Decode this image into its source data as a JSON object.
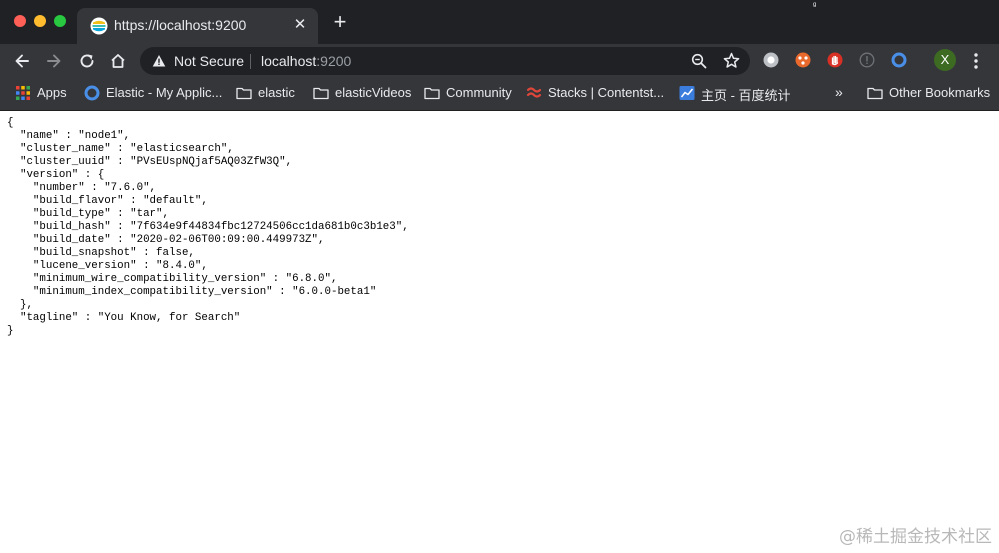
{
  "window": {
    "tab": {
      "title": "https://localhost:9200",
      "close_glyph": "✕",
      "favicon": "elastic-favicon-icon"
    },
    "new_tab_glyph": "+",
    "top_right_glyph": "ᵍ"
  },
  "toolbar": {
    "omnibox": {
      "security_label": "Not Secure",
      "host": "localhost",
      "port": ":9200"
    },
    "profile_initial": "X",
    "extensions": [
      "extension-grey-icon",
      "extension-orange-icon",
      "extension-red-hand-icon",
      "extension-info-icon",
      "extension-blue-ring-icon"
    ]
  },
  "bookmarks": {
    "items": [
      {
        "label": "Apps",
        "icon": "apps-grid-icon"
      },
      {
        "label": "Elastic - My Applic...",
        "icon": "circle-blue-icon"
      },
      {
        "label": "elastic",
        "icon": "folder-icon"
      },
      {
        "label": "elasticVideos",
        "icon": "folder-icon"
      },
      {
        "label": "Community",
        "icon": "folder-icon"
      },
      {
        "label": "Stacks | Contentst...",
        "icon": "contentstack-icon"
      },
      {
        "label": "主页 - 百度统计",
        "icon": "chart-icon"
      }
    ],
    "more_glyph": "»",
    "other": {
      "label": "Other Bookmarks",
      "icon": "folder-icon"
    }
  },
  "page": {
    "json_text": "{\n  \"name\" : \"node1\",\n  \"cluster_name\" : \"elasticsearch\",\n  \"cluster_uuid\" : \"PVsEUspNQjaf5AQ03ZfW3Q\",\n  \"version\" : {\n    \"number\" : \"7.6.0\",\n    \"build_flavor\" : \"default\",\n    \"build_type\" : \"tar\",\n    \"build_hash\" : \"7f634e9f44834fbc12724506cc1da681b0c3b1e3\",\n    \"build_date\" : \"2020-02-06T00:09:00.449973Z\",\n    \"build_snapshot\" : false,\n    \"lucene_version\" : \"8.4.0\",\n    \"minimum_wire_compatibility_version\" : \"6.8.0\",\n    \"minimum_index_compatibility_version\" : \"6.0.0-beta1\"\n  },\n  \"tagline\" : \"You Know, for Search\"\n}",
    "watermark": "@稀土掘金技术社区"
  },
  "colors": {
    "chrome_dark": "#202124",
    "chrome_toolbar": "#35363a",
    "text_light": "#e8eaed",
    "avatar_green": "#3d6b22"
  }
}
